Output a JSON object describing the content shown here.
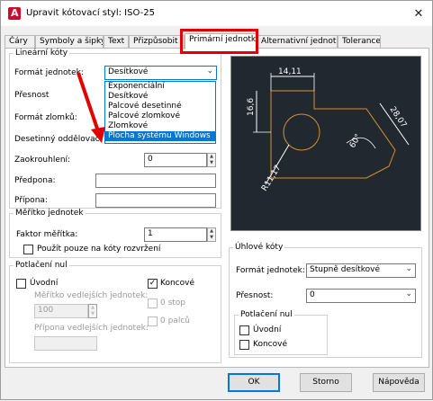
{
  "window": {
    "title": "Upravit kótovací styl: ISO-25",
    "close": "✕"
  },
  "tabs": [
    "Čáry",
    "Symboly a šipky",
    "Text",
    "Přizpůsobit",
    "Primární jednotky",
    "Alternativní jednotky",
    "Tolerance"
  ],
  "linear": {
    "legend": "Lineární kóty",
    "format_label": "Formát jednotek:",
    "format_value": "Desítkové",
    "precision_label": "Přesnost",
    "fraction_label": "Formát zlomků:",
    "decimal_sep_label": "Desetinný oddělovač:",
    "round_label": "Zaokrouhlení:",
    "round_value": "0",
    "prefix_label": "Předpona:",
    "prefix_value": "",
    "suffix_label": "Přípona:",
    "suffix_value": ""
  },
  "dropdown_options": [
    "Exponenciální",
    "Desítkové",
    "Palcové desetinné",
    "Palcové zlomkové",
    "Zlomkové",
    "Plocha systému Windows"
  ],
  "dropdown_selected_index": 5,
  "scale": {
    "legend": "Měřítko jednotek",
    "factor_label": "Faktor měřítka:",
    "factor_value": "1",
    "layout_only_label": "Použít pouze na kóty rozvržení"
  },
  "zero_suppression": {
    "legend": "Potlačení nul",
    "leading_label": "Úvodní",
    "trailing_label": "Koncové",
    "trailing_checked": true,
    "sub_factor_label": "Měřítko vedlejších jednotek:",
    "sub_factor_value": "100",
    "sub_suffix_label": "Přípona vedlejších jednotek:",
    "sub_suffix_value": "",
    "feet_label": "0 stop",
    "inches_label": "0 palců"
  },
  "angular": {
    "legend": "Úhlové kóty",
    "format_label": "Formát jednotek:",
    "format_value": "Stupně desítkové",
    "precision_label": "Přesnost:",
    "precision_value": "0",
    "zero_legend": "Potlačení nul",
    "leading_label": "Úvodní",
    "trailing_label": "Koncové"
  },
  "preview": {
    "dim_top": "14,11",
    "dim_left": "16,6",
    "dim_right": "28,07",
    "dim_angle": "60°",
    "dim_radius": "R11,17"
  },
  "buttons": {
    "ok": "OK",
    "cancel": "Storno",
    "help": "Nápověda"
  },
  "colors": {
    "accent": "#0078d7",
    "highlight_red": "#e00000",
    "preview_bg": "#212830",
    "geometry": "#d4922a",
    "dimension": "#ffffff"
  }
}
